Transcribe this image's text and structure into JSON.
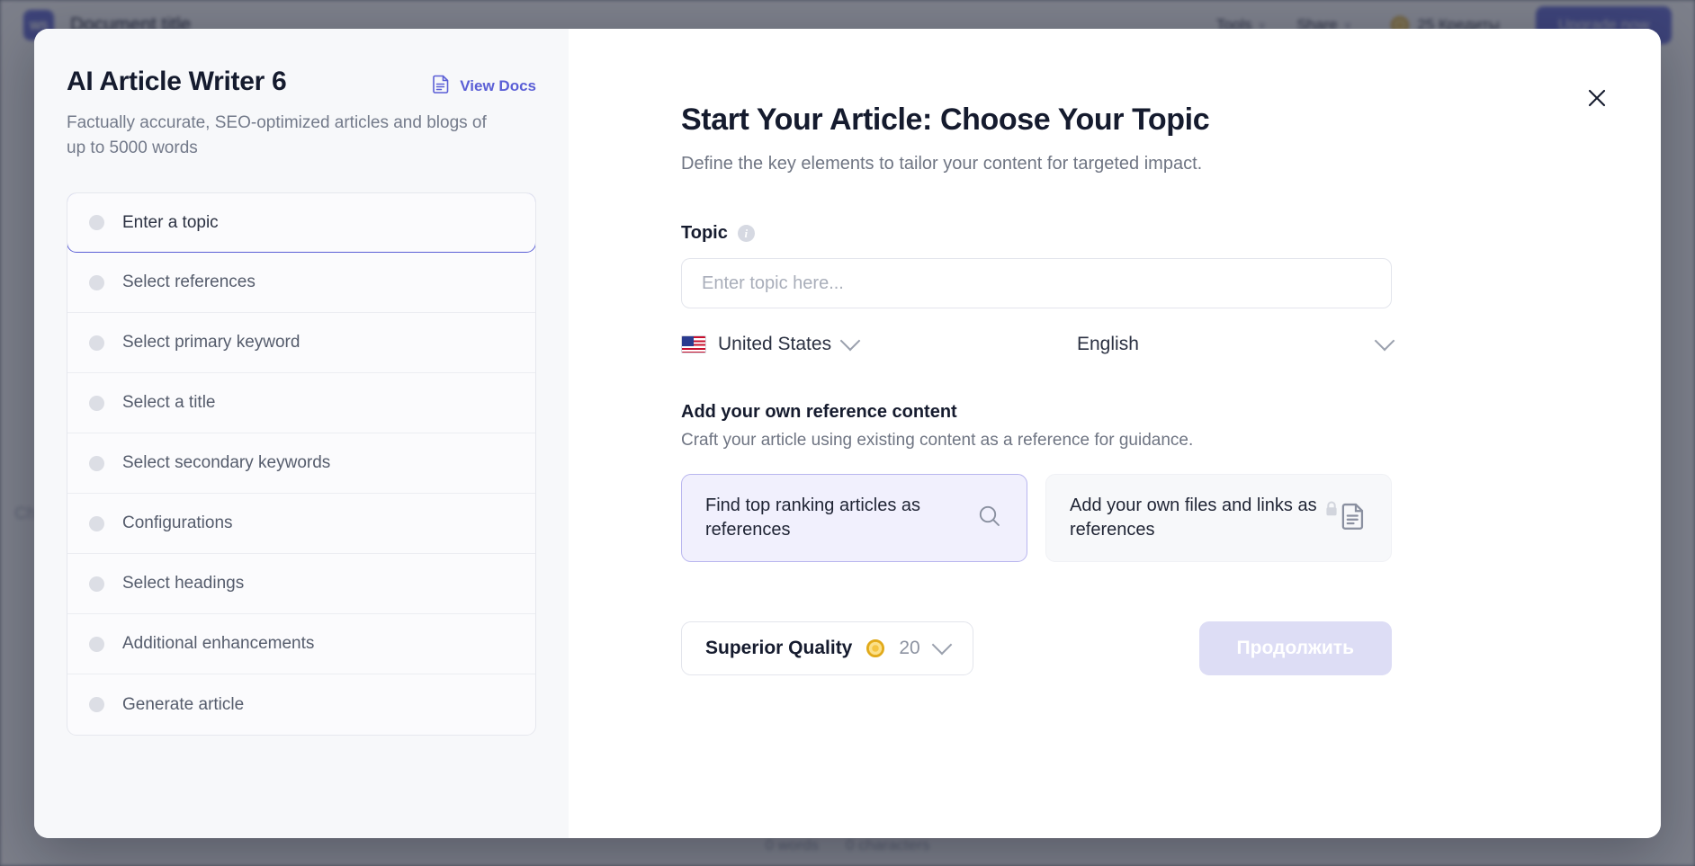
{
  "background": {
    "logo_text": "WS",
    "document_title": "Document title",
    "tools_label": "Tools",
    "share_label": "Share",
    "credits_label": "25 Кредиты",
    "upgrade_label": "Upgrade now",
    "canvas_note": "Ch",
    "status_words": "0 words",
    "status_characters": "0 characters",
    "chevron": "∨"
  },
  "modal": {
    "title": "AI Article Writer 6",
    "subtitle": "Factually accurate, SEO-optimized articles and blogs of up to 5000 words",
    "view_docs_label": "View Docs",
    "close_label": "✕",
    "accent_color": "#5b5fd6",
    "steps": [
      {
        "label": "Enter a topic",
        "active": true
      },
      {
        "label": "Select references",
        "active": false
      },
      {
        "label": "Select primary keyword",
        "active": false
      },
      {
        "label": "Select a title",
        "active": false
      },
      {
        "label": "Select secondary keywords",
        "active": false
      },
      {
        "label": "Configurations",
        "active": false
      },
      {
        "label": "Select headings",
        "active": false
      },
      {
        "label": "Additional enhancements",
        "active": false
      },
      {
        "label": "Generate article",
        "active": false
      }
    ]
  },
  "main": {
    "section_title": "Start Your Article: Choose Your Topic",
    "section_subtitle": "Define the key elements to tailor your content for targeted impact.",
    "topic_label": "Topic",
    "topic_value": "",
    "topic_placeholder": "Enter topic here...",
    "country_value": "United States",
    "language_value": "English",
    "reference_heading": "Add your own reference content",
    "reference_subtitle": "Craft your article using existing content as a reference for guidance.",
    "reference_cards": [
      {
        "label": "Find top ranking articles as references",
        "selected": true,
        "locked": false
      },
      {
        "label": "Add your own files and links as references",
        "selected": false,
        "locked": true
      }
    ],
    "quality_label": "Superior Quality",
    "quality_credits": "20",
    "continue_label": "Продолжить"
  }
}
